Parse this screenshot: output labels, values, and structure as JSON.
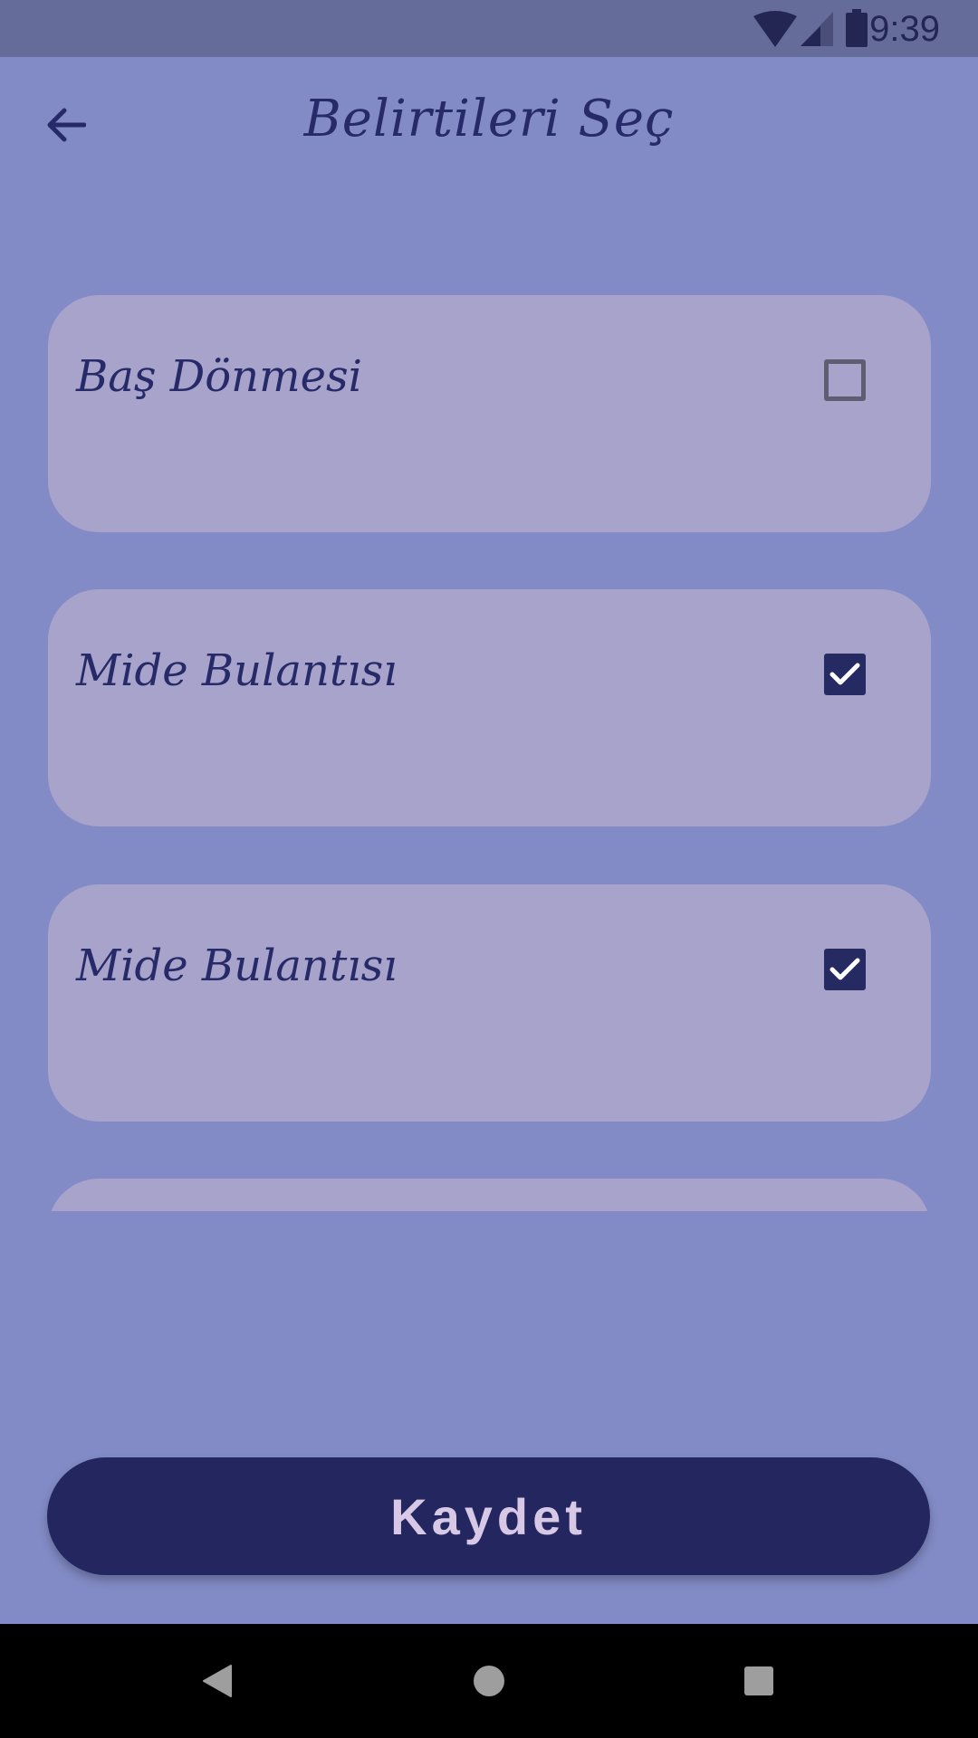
{
  "status_bar": {
    "time": "9:39",
    "icons": [
      "wifi-icon",
      "signal-icon",
      "battery-icon"
    ]
  },
  "header": {
    "title": "Belirtileri Seç",
    "back_icon": "back-arrow-icon"
  },
  "symptoms": [
    {
      "label": "Baş Dönmesi",
      "checked": false
    },
    {
      "label": "Mide Bulantısı",
      "checked": true
    },
    {
      "label": "Mide Bulantısı",
      "checked": true
    }
  ],
  "save_button": {
    "label": "Kaydet"
  },
  "nav_bar": {
    "icons": [
      "back-nav-icon",
      "home-nav-icon",
      "recents-nav-icon"
    ]
  },
  "colors": {
    "background": "#838BC6",
    "status_bar": "#666C9A",
    "card": "#A8A3CB",
    "primary": "#23265F",
    "text": "#272A68",
    "button_text": "#D7C8E6"
  }
}
